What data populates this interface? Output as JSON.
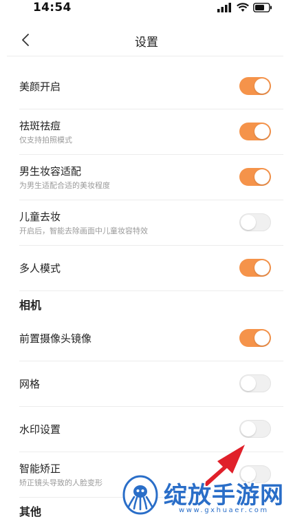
{
  "status_bar": {
    "time": "14:54"
  },
  "nav": {
    "title": "设置"
  },
  "settings": [
    {
      "label": "美颜开启",
      "sub": "",
      "on": true
    },
    {
      "label": "祛斑祛痘",
      "sub": "仅支持拍照模式",
      "on": true
    },
    {
      "label": "男生妆容适配",
      "sub": "为男生适配合适的美妆程度",
      "on": true
    },
    {
      "label": "儿童去妆",
      "sub": "开启后，智能去除画面中儿童妆容特效",
      "on": false
    },
    {
      "label": "多人模式",
      "sub": "",
      "on": true
    }
  ],
  "camera_section": {
    "title": "相机",
    "items": [
      {
        "label": "前置摄像头镜像",
        "sub": "",
        "on": true
      },
      {
        "label": "网格",
        "sub": "",
        "on": false
      },
      {
        "label": "水印设置",
        "sub": "",
        "on": false
      },
      {
        "label": "智能矫正",
        "sub": "矫正镜头导致的人脸变形",
        "on": false
      }
    ]
  },
  "other_section": {
    "title": "其他"
  },
  "watermark": {
    "text": "绽放手游网",
    "url": "www.gxhuaer.com"
  },
  "colors": {
    "toggle_on": "#f5934a",
    "toggle_off": "#f0f0f0",
    "arrow": "#e0202a",
    "watermark": "#2a6ec8"
  }
}
